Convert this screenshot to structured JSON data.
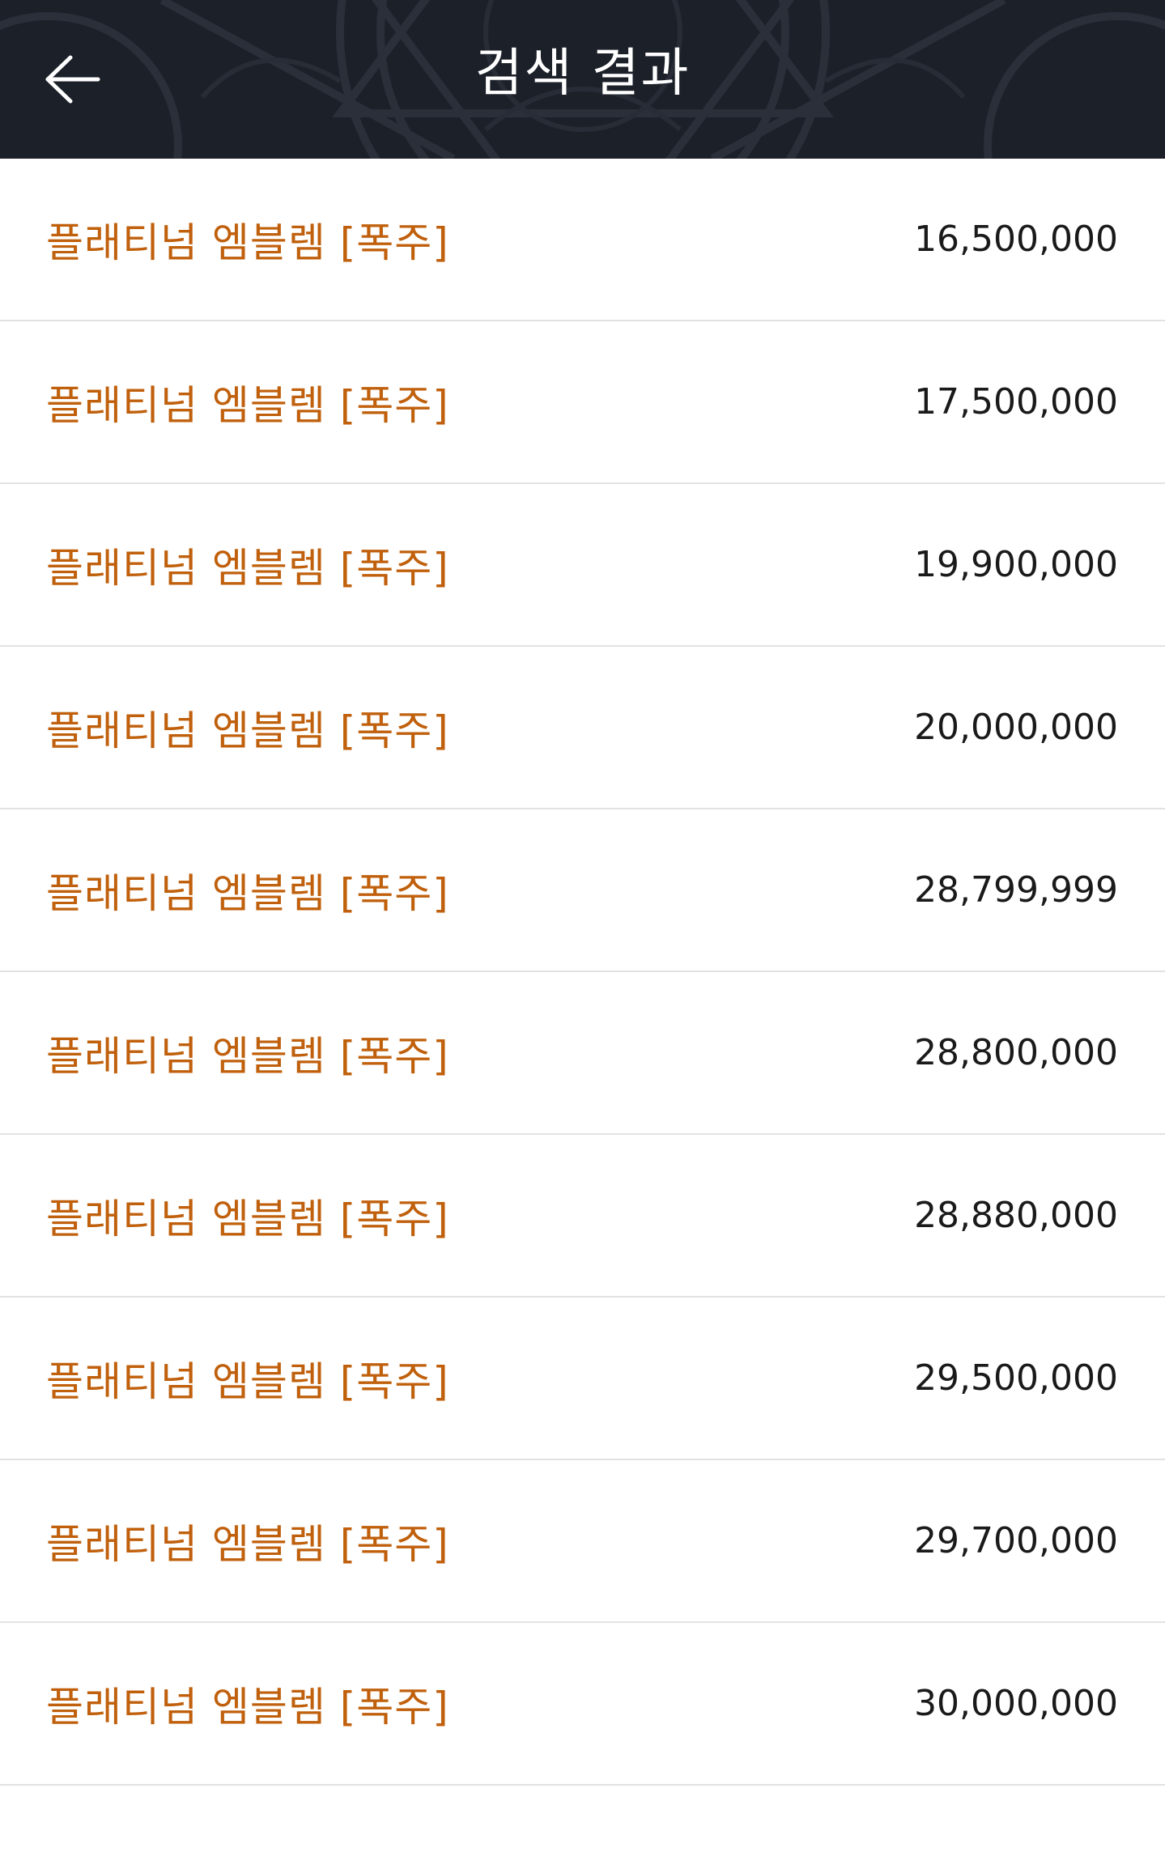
{
  "header": {
    "title": "검색 결과",
    "back_icon": "arrow-left-icon",
    "background_color": "#1c2029"
  },
  "colors": {
    "item_name": "#c0600c",
    "price": "#1a1a1a",
    "divider": "#e2e2e2"
  },
  "results": [
    {
      "name": "플래티넘 엠블렘 [폭주]",
      "price": "16,500,000"
    },
    {
      "name": "플래티넘 엠블렘 [폭주]",
      "price": "17,500,000"
    },
    {
      "name": "플래티넘 엠블렘 [폭주]",
      "price": "19,900,000"
    },
    {
      "name": "플래티넘 엠블렘 [폭주]",
      "price": "20,000,000"
    },
    {
      "name": "플래티넘 엠블렘 [폭주]",
      "price": "28,799,999"
    },
    {
      "name": "플래티넘 엠블렘 [폭주]",
      "price": "28,800,000"
    },
    {
      "name": "플래티넘 엠블렘 [폭주]",
      "price": "28,880,000"
    },
    {
      "name": "플래티넘 엠블렘 [폭주]",
      "price": "29,500,000"
    },
    {
      "name": "플래티넘 엠블렘 [폭주]",
      "price": "29,700,000"
    },
    {
      "name": "플래티넘 엠블렘 [폭주]",
      "price": "30,000,000"
    }
  ]
}
